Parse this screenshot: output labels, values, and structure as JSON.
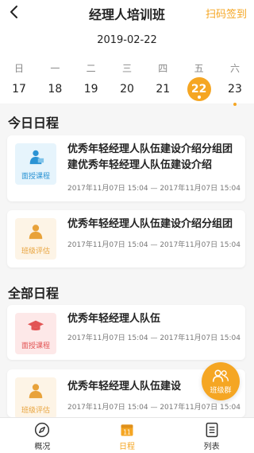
{
  "header": {
    "title": "经理人培训班",
    "scan_label": "扫码签到"
  },
  "calendar": {
    "date": "2019-02-22",
    "weekdays": [
      "日",
      "一",
      "二",
      "三",
      "四",
      "五",
      "六"
    ],
    "days": [
      "17",
      "18",
      "19",
      "20",
      "21",
      "22",
      "23"
    ],
    "selected_day": "22"
  },
  "today": {
    "section_title": "今日日程",
    "items": [
      {
        "icon": "presenter-icon",
        "label": "面授课程",
        "title": "优秀年轻经理人队伍建设介绍分组团建优秀年轻经理人队伍建设介绍",
        "time": "2017年11月07日 15:04  —  2017年11月07日 15:04"
      },
      {
        "icon": "user-icon",
        "label": "班级评估",
        "title": "优秀年轻经理人队伍建设介绍分组团",
        "time": "2017年11月07日 15:04  —  2017年11月07日 15:04"
      }
    ]
  },
  "all": {
    "section_title": "全部日程",
    "items": [
      {
        "icon": "graduation-cap-icon",
        "label": "面授课程",
        "title": "优秀年轻经理人队伍",
        "time": "2017年11月07日 15:04  —  2017年11月07日 15:04"
      },
      {
        "icon": "user-icon",
        "label": "班级评估",
        "title": "优秀年轻经理人队伍建设",
        "time": "2017年11月07日 15:04  —  2017年11月07日 15:04"
      }
    ]
  },
  "floating": {
    "label": "班级群"
  },
  "tabbar": {
    "items": [
      {
        "label": "概况",
        "icon": "compass-icon",
        "active": false
      },
      {
        "label": "日程",
        "icon": "calendar-icon",
        "active": true
      },
      {
        "label": "列表",
        "icon": "list-icon",
        "active": false
      }
    ]
  },
  "colors": {
    "accent": "#f5a623",
    "blue": "#2b93d4",
    "red": "#e25454"
  }
}
